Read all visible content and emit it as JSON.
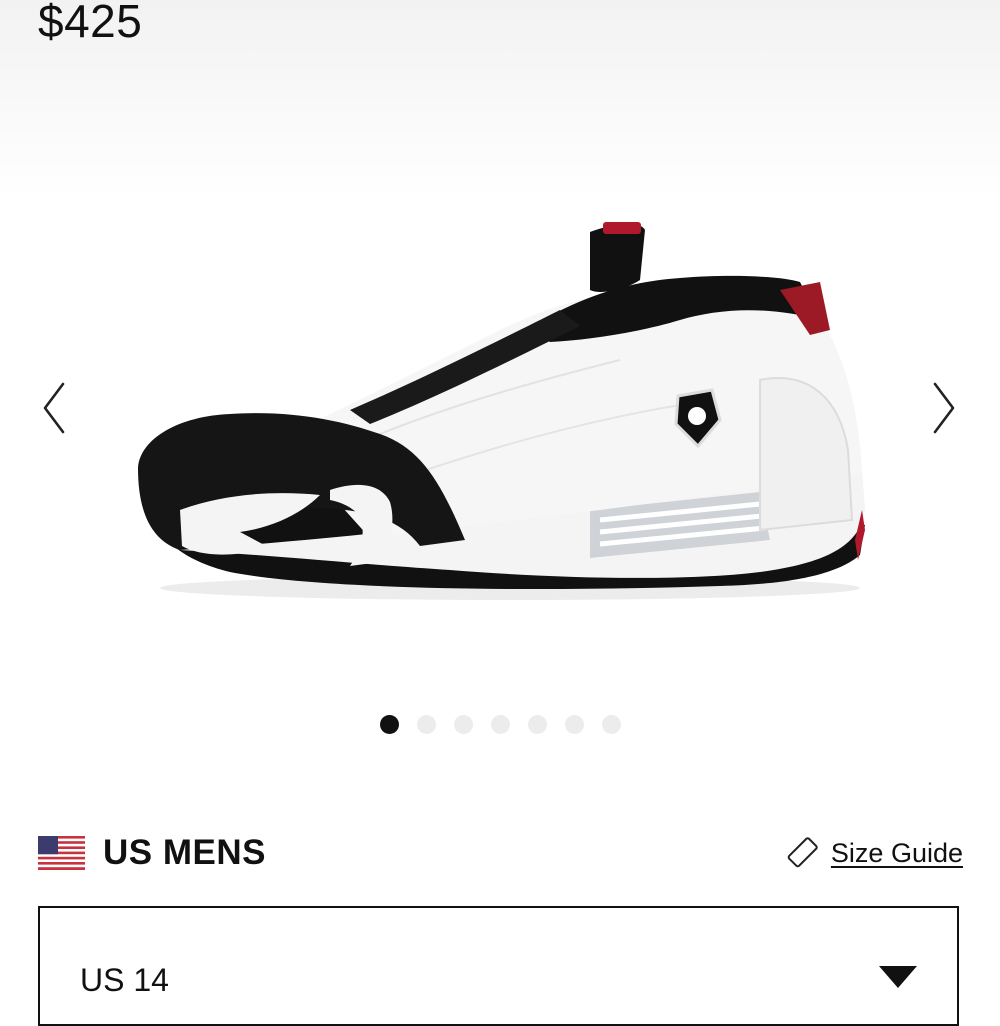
{
  "product": {
    "price": "$425",
    "image_alt": "Air Jordan 14 sneaker, white leather with black suede toe and red accents",
    "colors": {
      "black": "#111111",
      "white": "#ffffff",
      "red": "#b0192b"
    }
  },
  "carousel": {
    "prev_icon": "chevron-left-icon",
    "next_icon": "chevron-right-icon",
    "dot_count": 7,
    "active_index": 0
  },
  "size": {
    "region_flag": "us-flag-icon",
    "region_label": "US MENS",
    "guide_icon": "ruler-tag-icon",
    "guide_label": "Size Guide",
    "selected": "US 14",
    "dropdown_icon": "caret-down-icon"
  }
}
